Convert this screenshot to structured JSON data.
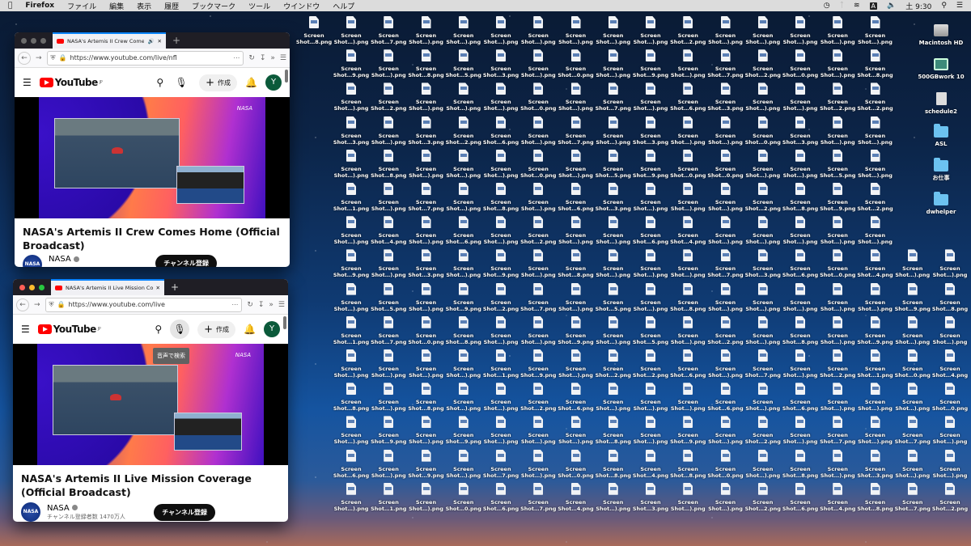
{
  "menubar": {
    "apple": "",
    "app": "Firefox",
    "items": [
      "ファイル",
      "編集",
      "表示",
      "履歴",
      "ブックマーク",
      "ツール",
      "ウインドウ",
      "ヘルプ"
    ],
    "input_mode": "A",
    "clock": "土 9:30"
  },
  "desktop": {
    "file_prefix": "Screen",
    "file_rows": [
      [
        ")",
        "7",
        ")",
        ")",
        ")",
        ")",
        ")",
        ")",
        ")",
        "2",
        ")",
        ")",
        ")",
        ")",
        ")"
      ],
      [
        "9",
        ")",
        "8",
        "5",
        "3",
        ")",
        "0",
        ")",
        "9",
        ")",
        "7",
        "2",
        "0",
        ")",
        "8"
      ],
      [
        ")",
        "2",
        ")",
        ")",
        ")",
        "0",
        ")",
        "7",
        ")",
        "6",
        "3",
        ")",
        ")",
        "2",
        "2"
      ],
      [
        "3",
        ")",
        "3",
        "2",
        "6",
        ")",
        "7",
        ")",
        "3",
        ")",
        ")",
        "0",
        "3",
        ")",
        ")"
      ],
      [
        ")",
        "8",
        ")",
        ")",
        ")",
        "0",
        ")",
        "5",
        "9",
        "0",
        "0",
        ")",
        ")",
        "5",
        ")"
      ],
      [
        "1",
        ")",
        "7",
        ")",
        "8",
        ")",
        "6",
        "3",
        ")",
        ")",
        ")",
        "2",
        "8",
        "9",
        "2"
      ],
      [
        ")",
        "4",
        ")",
        "6",
        ")",
        "2",
        ")",
        ")",
        "6",
        "4",
        ")",
        ")",
        ")",
        ")",
        ")"
      ],
      [
        "9",
        ")",
        "3",
        ")",
        "9",
        ")",
        "8",
        ")",
        ")",
        ")",
        "7",
        "3",
        "6",
        "0",
        "4",
        ")",
        ")"
      ],
      [
        ")",
        "5",
        ")",
        "9",
        "2",
        "7",
        ")",
        "5",
        ")",
        "8",
        ")",
        ")",
        ")",
        ")",
        ")",
        "9",
        "8"
      ],
      [
        "1",
        "7",
        "0",
        "8",
        ")",
        ")",
        "9",
        ")",
        "5",
        ")",
        "2",
        ")",
        "8",
        ")",
        "9",
        ")",
        ")"
      ],
      [
        ")",
        ")",
        ")",
        ")",
        "1",
        "9",
        ")",
        "2",
        "2",
        "6",
        ")",
        "7",
        ")",
        "2",
        "1",
        "0",
        "4"
      ],
      [
        "8",
        ")",
        "8",
        ")",
        ")",
        "2",
        "6",
        ")",
        ")",
        ")",
        "6",
        ")",
        "6",
        ")",
        ")",
        ")",
        "0"
      ],
      [
        ")",
        "9",
        ")",
        "9",
        ")",
        ")",
        ")",
        "8",
        ")",
        "9",
        ")",
        "2",
        ")",
        "7",
        ")",
        "7",
        ")"
      ],
      [
        "6",
        ")",
        "9",
        ")",
        "7",
        ")",
        "0",
        "8",
        "4",
        "8",
        "0",
        ")",
        "8",
        ")",
        "3",
        ")",
        ")"
      ],
      [
        ")",
        "1",
        ")",
        "0",
        "6",
        "7",
        "4",
        ")",
        "3",
        ")",
        ")",
        "2",
        "6",
        "4",
        "8",
        "7",
        "2"
      ]
    ],
    "extra_file": "8",
    "volumes": [
      {
        "name": "Macintosh HD",
        "type": "hd"
      },
      {
        "name": "500GBwork 10",
        "type": "ext"
      },
      {
        "name": "schedule2",
        "type": "sched"
      },
      {
        "name": "ASL",
        "type": "folder"
      },
      {
        "name": "お仕事",
        "type": "folder"
      },
      {
        "name": "dwhelper",
        "type": "folder"
      }
    ]
  },
  "windows": [
    {
      "tab_title": "NASA's Artemis II Crew Comes Home (Official Broadcast) - YouTube",
      "url": "https://www.youtube.com/live/nfl",
      "logo": "YouTube",
      "region": "JP",
      "create": "作成",
      "avatar": "Y",
      "video_bug": "NASA",
      "title": "NASA's Artemis II Crew Comes Home (Official Broadcast)",
      "channel": "NASA",
      "subscribe": "チャンネル登録",
      "subs": ""
    },
    {
      "tab_title": "NASA's Artemis II Live Mission Coverage (Official Broadcast) - YouTube",
      "url": "https://www.youtube.com/live",
      "logo": "YouTube",
      "region": "JP",
      "create": "作成",
      "avatar": "Y",
      "video_bug": "NASA",
      "tooltip": "音声で検索",
      "title": "NASA's Artemis II Live Mission Coverage (Official Broadcast)",
      "channel": "NASA",
      "subscribe": "チャンネル登録",
      "subs": "チャンネル登録者数 1470万人"
    }
  ],
  "colors": {
    "accent": "#0a84ff",
    "youtube_red": "#ff0000",
    "avatar": "#0b5a3a"
  }
}
